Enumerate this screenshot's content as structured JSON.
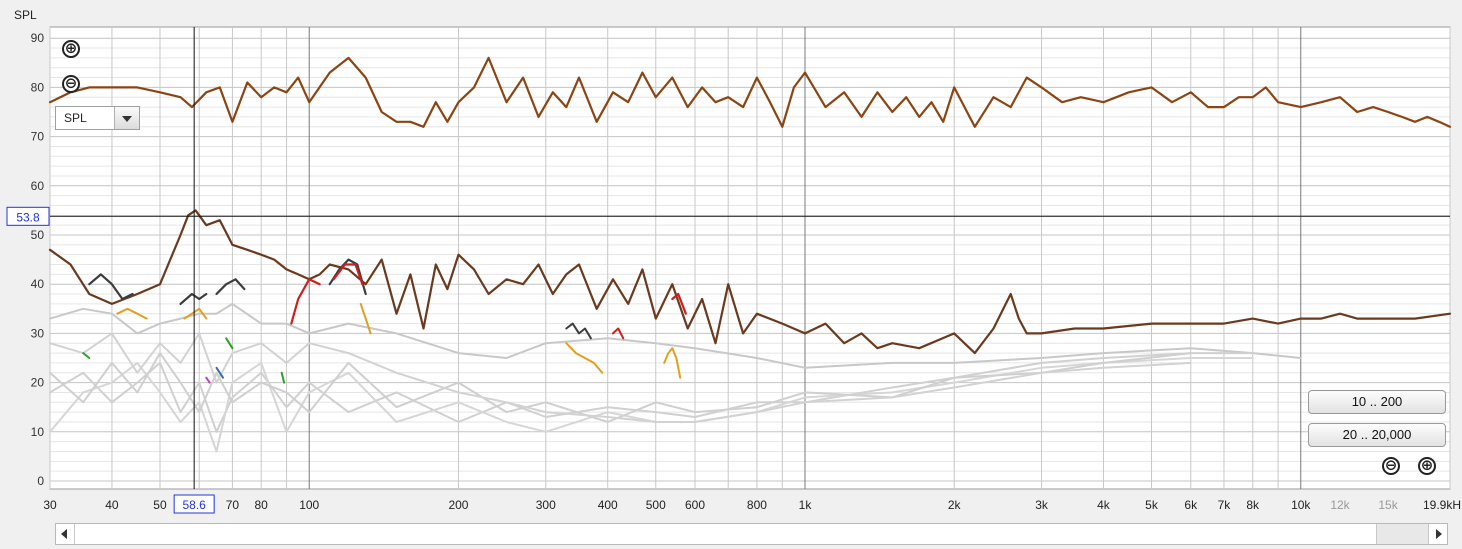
{
  "chart_data": {
    "type": "line",
    "ylabel": "SPL",
    "ylim": [
      0,
      90
    ],
    "yticks": [
      "0",
      "10",
      "20",
      "30",
      "40",
      "50",
      "60",
      "70",
      "80",
      "90"
    ],
    "xlim": [
      30,
      20000
    ],
    "xscale": "log",
    "xticks": [
      {
        "f": 30,
        "label": "30"
      },
      {
        "f": 40,
        "label": "40"
      },
      {
        "f": 50,
        "label": "50"
      },
      {
        "f": 70,
        "label": "70"
      },
      {
        "f": 80,
        "label": "80"
      },
      {
        "f": 100,
        "label": "100"
      },
      {
        "f": 200,
        "label": "200"
      },
      {
        "f": 300,
        "label": "300"
      },
      {
        "f": 400,
        "label": "400"
      },
      {
        "f": 500,
        "label": "500"
      },
      {
        "f": 600,
        "label": "600"
      },
      {
        "f": 800,
        "label": "800"
      },
      {
        "f": 1000,
        "label": "1k"
      },
      {
        "f": 2000,
        "label": "2k"
      },
      {
        "f": 3000,
        "label": "3k"
      },
      {
        "f": 4000,
        "label": "4k"
      },
      {
        "f": 5000,
        "label": "5k"
      },
      {
        "f": 6000,
        "label": "6k"
      },
      {
        "f": 7000,
        "label": "7k"
      },
      {
        "f": 8000,
        "label": "8k"
      },
      {
        "f": 10000,
        "label": "10k"
      },
      {
        "f": 12000,
        "label": "12k"
      },
      {
        "f": 15000,
        "label": "15k"
      }
    ],
    "xtick_end_label": "19.9kH",
    "cursor": {
      "x": 58.6,
      "y": 53.8,
      "x_label": "58.6",
      "y_label": "53.8"
    },
    "grid": true,
    "series": [
      {
        "color": "#8b4513",
        "width": 2.2,
        "x": [
          30,
          33,
          36,
          40,
          45,
          50,
          55,
          58,
          62,
          66,
          70,
          75,
          80,
          85,
          90,
          95,
          100,
          110,
          120,
          130,
          140,
          150,
          160,
          170,
          180,
          190,
          200,
          215,
          230,
          250,
          270,
          290,
          310,
          330,
          350,
          380,
          410,
          440,
          470,
          500,
          540,
          580,
          620,
          660,
          700,
          750,
          800,
          850,
          900,
          950,
          1000,
          1100,
          1200,
          1300,
          1400,
          1500,
          1600,
          1700,
          1800,
          1900,
          2000,
          2200,
          2400,
          2600,
          2800,
          3000,
          3300,
          3600,
          4000,
          4500,
          5000,
          5500,
          6000,
          6500,
          7000,
          7500,
          8000,
          8500,
          9000,
          10000,
          11000,
          12000,
          13000,
          14000,
          15000,
          16000,
          17000,
          18000,
          19000,
          20000
        ],
        "y": [
          77,
          79,
          80,
          80,
          80,
          79,
          78,
          76,
          79,
          80,
          73,
          81,
          78,
          80,
          79,
          82,
          77,
          83,
          86,
          82,
          75,
          73,
          73,
          72,
          77,
          73,
          77,
          80,
          86,
          77,
          82,
          74,
          79,
          76,
          82,
          73,
          79,
          77,
          83,
          78,
          82,
          76,
          80,
          77,
          78,
          76,
          82,
          77,
          72,
          80,
          83,
          76,
          79,
          74,
          79,
          75,
          78,
          74,
          77,
          73,
          80,
          72,
          78,
          76,
          82,
          80,
          77,
          78,
          77,
          79,
          80,
          77,
          79,
          76,
          76,
          78,
          78,
          80,
          77,
          76,
          77,
          78,
          75,
          76,
          75,
          74,
          73,
          74,
          73,
          72
        ]
      },
      {
        "color": "#6b3a1e",
        "width": 2.2,
        "x": [
          30,
          33,
          36,
          40,
          45,
          50,
          55,
          57,
          59,
          62,
          66,
          70,
          75,
          80,
          85,
          90,
          95,
          100,
          105,
          110,
          120,
          130,
          140,
          150,
          160,
          170,
          180,
          190,
          200,
          215,
          230,
          250,
          270,
          290,
          310,
          330,
          350,
          380,
          410,
          440,
          470,
          500,
          540,
          580,
          620,
          660,
          700,
          750,
          800,
          900,
          1000,
          1100,
          1200,
          1300,
          1400,
          1500,
          1700,
          2000,
          2200,
          2400,
          2600,
          2700,
          2800,
          3000,
          3500,
          4000,
          5000,
          6000,
          7000,
          8000,
          9000,
          10000,
          11000,
          12000,
          13000,
          15000,
          17000,
          20000
        ],
        "y": [
          47,
          44,
          38,
          36,
          38,
          40,
          50,
          54,
          55,
          52,
          53,
          48,
          47,
          46,
          45,
          43,
          42,
          41,
          42,
          44,
          43,
          40,
          45,
          34,
          42,
          31,
          44,
          39,
          46,
          43,
          38,
          41,
          40,
          44,
          38,
          42,
          44,
          35,
          41,
          36,
          43,
          33,
          40,
          31,
          37,
          28,
          40,
          30,
          34,
          32,
          30,
          32,
          28,
          30,
          27,
          28,
          27,
          30,
          26,
          31,
          38,
          33,
          30,
          30,
          31,
          31,
          32,
          32,
          32,
          33,
          32,
          33,
          33,
          34,
          33,
          33,
          33,
          34
        ]
      },
      {
        "color": "#c8c8c8",
        "width": 2,
        "x": [
          30,
          35,
          40,
          45,
          50,
          55,
          60,
          65,
          70,
          80,
          90,
          100,
          120,
          150,
          200,
          250,
          300,
          400,
          500,
          600,
          800,
          1000,
          1500,
          2000,
          3000,
          4000,
          6000,
          8000,
          10000
        ],
        "y": [
          33,
          35,
          34,
          30,
          32,
          33,
          34,
          34,
          36,
          32,
          32,
          30,
          32,
          30,
          26,
          25,
          28,
          29,
          28,
          27,
          25,
          23,
          24,
          24,
          25,
          26,
          27,
          26,
          25
        ]
      },
      {
        "color": "#d0d0d0",
        "width": 2,
        "x": [
          30,
          35,
          40,
          45,
          50,
          55,
          60,
          65,
          70,
          80,
          90,
          100,
          120,
          150,
          200,
          250,
          300,
          400,
          500,
          600,
          800,
          1000,
          1500,
          2000,
          3000,
          4000,
          6000,
          8000
        ],
        "y": [
          18,
          22,
          16,
          20,
          24,
          14,
          20,
          10,
          17,
          22,
          15,
          20,
          14,
          18,
          12,
          16,
          13,
          15,
          14,
          13,
          16,
          16,
          19,
          21,
          24,
          25,
          26,
          26
        ]
      },
      {
        "color": "#d6d6d6",
        "width": 2,
        "x": [
          30,
          35,
          40,
          45,
          50,
          55,
          60,
          65,
          70,
          80,
          90,
          100,
          120,
          150,
          200,
          250,
          300,
          400,
          500,
          600,
          800,
          1000,
          1500,
          2000,
          3000,
          4000,
          6000,
          8000
        ],
        "y": [
          10,
          18,
          20,
          24,
          18,
          12,
          16,
          6,
          20,
          24,
          10,
          18,
          22,
          12,
          16,
          12,
          10,
          14,
          12,
          12,
          14,
          17,
          18,
          20,
          23,
          24,
          25,
          25
        ]
      },
      {
        "color": "#cfcfcf",
        "width": 2,
        "x": [
          30,
          35,
          40,
          45,
          50,
          55,
          60,
          65,
          70,
          80,
          90,
          100,
          120,
          150,
          200,
          250,
          300,
          400,
          500,
          600,
          800,
          1000,
          1500,
          2000,
          3000,
          4000,
          6000
        ],
        "y": [
          22,
          16,
          24,
          18,
          26,
          20,
          14,
          22,
          16,
          20,
          18,
          14,
          24,
          15,
          20,
          14,
          16,
          12,
          16,
          14,
          15,
          18,
          17,
          21,
          22,
          24,
          26
        ]
      },
      {
        "color": "#d2d2d2",
        "width": 2,
        "x": [
          30,
          35,
          40,
          45,
          50,
          55,
          60,
          65,
          70,
          80,
          90,
          100,
          120,
          150,
          200,
          250,
          300,
          400,
          500,
          600,
          800,
          1000,
          1500,
          2000,
          3000,
          4000,
          6000
        ],
        "y": [
          28,
          26,
          30,
          22,
          28,
          24,
          30,
          20,
          26,
          28,
          24,
          28,
          26,
          22,
          18,
          16,
          14,
          13,
          12,
          12,
          14,
          16,
          17,
          19,
          22,
          23,
          24
        ]
      },
      {
        "color": "#3c3c3c",
        "width": 2.2,
        "x": [
          36,
          38,
          40,
          42,
          44
        ],
        "y": [
          40,
          42,
          40,
          37,
          38
        ]
      },
      {
        "color": "#3c3c3c",
        "width": 2.2,
        "x": [
          55,
          58,
          60,
          62
        ],
        "y": [
          36,
          38,
          37,
          38
        ]
      },
      {
        "color": "#e0a020",
        "width": 2,
        "x": [
          41,
          43,
          45,
          47
        ],
        "y": [
          34,
          35,
          34,
          33
        ]
      },
      {
        "color": "#e0a020",
        "width": 2,
        "x": [
          56,
          58,
          60,
          62
        ],
        "y": [
          33,
          34,
          35,
          33
        ]
      },
      {
        "color": "#3c3c3c",
        "width": 2.2,
        "x": [
          65,
          68,
          71,
          74
        ],
        "y": [
          38,
          40,
          41,
          39
        ]
      },
      {
        "color": "#cc1f1f",
        "width": 2.2,
        "x": [
          92,
          95,
          100,
          105
        ],
        "y": [
          32,
          37,
          41,
          40
        ]
      },
      {
        "color": "#3c3c3c",
        "width": 2.2,
        "x": [
          110,
          115,
          120,
          125,
          130
        ],
        "y": [
          40,
          43,
          45,
          44,
          38
        ]
      },
      {
        "color": "#cc1f1f",
        "width": 2.2,
        "x": [
          112,
          118,
          124,
          128
        ],
        "y": [
          41,
          44,
          44,
          40
        ]
      },
      {
        "color": "#e0a020",
        "width": 2,
        "x": [
          127,
          130,
          133
        ],
        "y": [
          36,
          33,
          30
        ]
      },
      {
        "color": "#3c3c3c",
        "width": 2,
        "x": [
          330,
          340,
          350,
          360,
          370
        ],
        "y": [
          31,
          32,
          30,
          31,
          29
        ]
      },
      {
        "color": "#cc1f1f",
        "width": 2,
        "x": [
          410,
          420,
          430
        ],
        "y": [
          30,
          31,
          29
        ]
      },
      {
        "color": "#e0a020",
        "width": 2,
        "x": [
          330,
          345,
          360,
          375,
          390
        ],
        "y": [
          28,
          26,
          25,
          24,
          22
        ]
      },
      {
        "color": "#e0a020",
        "width": 2,
        "x": [
          520,
          530,
          540,
          550,
          560
        ],
        "y": [
          24,
          26,
          27,
          25,
          21
        ]
      },
      {
        "color": "#cc1f1f",
        "width": 2.2,
        "x": [
          540,
          555,
          565,
          575
        ],
        "y": [
          37,
          38,
          36,
          34
        ]
      },
      {
        "color": "#2e9e2e",
        "width": 2,
        "x": [
          35,
          36
        ],
        "y": [
          26,
          25
        ]
      },
      {
        "color": "#2e9e2e",
        "width": 2,
        "x": [
          68,
          70
        ],
        "y": [
          29,
          27
        ]
      },
      {
        "color": "#3a6ab0",
        "width": 2,
        "x": [
          65,
          66,
          67
        ],
        "y": [
          23,
          22,
          21
        ]
      },
      {
        "color": "#c040c0",
        "width": 2,
        "x": [
          62,
          63
        ],
        "y": [
          21,
          20
        ]
      },
      {
        "color": "#2e9e2e",
        "width": 2,
        "x": [
          88,
          89
        ],
        "y": [
          22,
          20
        ]
      }
    ]
  },
  "controls": {
    "zoom_in_symbol": "⊕",
    "zoom_out_symbol": "⊖",
    "measure_select_value": "SPL",
    "range_button_1": "10 .. 200",
    "range_button_2": "20 .. 20,000"
  }
}
